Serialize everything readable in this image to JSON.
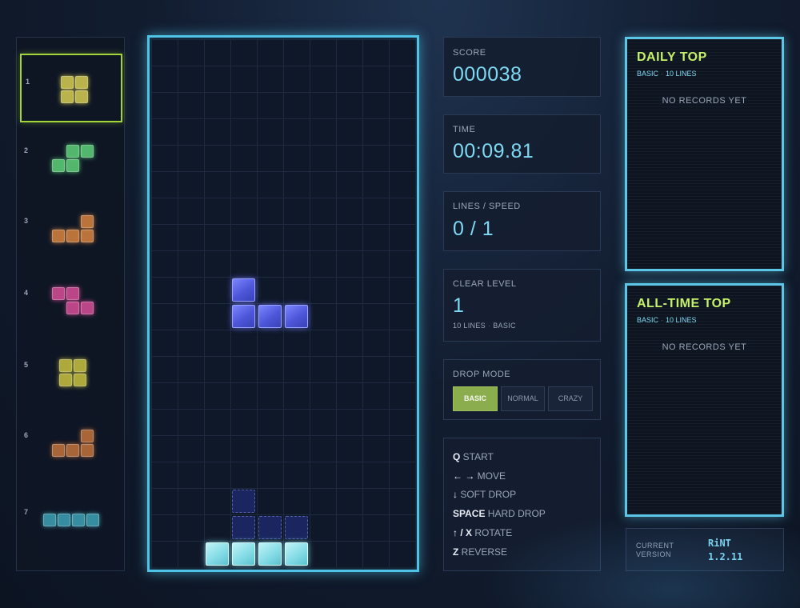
{
  "queue": {
    "active_index": 0,
    "items": [
      {
        "num": "1",
        "color": "#d9cf52",
        "shape": "O"
      },
      {
        "num": "2",
        "color": "#5fd47a",
        "shape": "S"
      },
      {
        "num": "3",
        "color": "#d98540",
        "shape": "L"
      },
      {
        "num": "4",
        "color": "#d94f9a",
        "shape": "Z"
      },
      {
        "num": "5",
        "color": "#c9c440",
        "shape": "O"
      },
      {
        "num": "6",
        "color": "#c2733c",
        "shape": "L"
      },
      {
        "num": "7",
        "color": "#3fa3b6",
        "shape": "I"
      }
    ]
  },
  "board": {
    "columns": 10,
    "rows": 20,
    "active_piece": {
      "type": "J",
      "color": "blue",
      "cells": [
        [
          3,
          9
        ],
        [
          3,
          10
        ],
        [
          4,
          10
        ],
        [
          5,
          10
        ]
      ]
    },
    "ghost_piece": {
      "cells": [
        [
          3,
          17
        ],
        [
          3,
          18
        ],
        [
          4,
          18
        ],
        [
          5,
          18
        ]
      ]
    },
    "locked_cells": [
      [
        2,
        19
      ],
      [
        3,
        19
      ],
      [
        4,
        19
      ],
      [
        5,
        19
      ]
    ],
    "locked_color": "cyan"
  },
  "stats": {
    "score_label": "SCORE",
    "score": "000038",
    "time_label": "TIME",
    "time": "00:09.81",
    "lines_label": "LINES / SPEED",
    "lines_speed": "0 / 1",
    "clear_label": "CLEAR LEVEL",
    "clear_level": "1",
    "clear_lines": "10 LINES",
    "clear_mode": "BASIC"
  },
  "drop_mode": {
    "label": "DROP MODE",
    "options": [
      "BASIC",
      "NORMAL",
      "CRAZY"
    ],
    "selected": "BASIC"
  },
  "controls": [
    {
      "key": "Q",
      "action": "START"
    },
    {
      "key": "← →",
      "action": "MOVE"
    },
    {
      "key": "↓",
      "action": "SOFT DROP"
    },
    {
      "key": "SPACE",
      "action": "HARD DROP"
    },
    {
      "key": "↑ / X",
      "action": "ROTATE"
    },
    {
      "key": "Z",
      "action": "REVERSE"
    }
  ],
  "daily_top": {
    "title": "DAILY TOP",
    "mode": "BASIC",
    "lines": "10 LINES",
    "empty": "NO RECORDS YET"
  },
  "alltime_top": {
    "title": "ALL-TIME TOP",
    "mode": "BASIC",
    "lines": "10 LINES",
    "empty": "NO RECORDS YET"
  },
  "version": {
    "label_line1": "CURRENT",
    "label_line2": "VERSION",
    "name": "RiNT",
    "number": "1.2.11"
  },
  "colors": {
    "accent_cyan": "#4fc3e6",
    "accent_green": "#c6f06a",
    "selected_mode": "#8cad4e"
  }
}
